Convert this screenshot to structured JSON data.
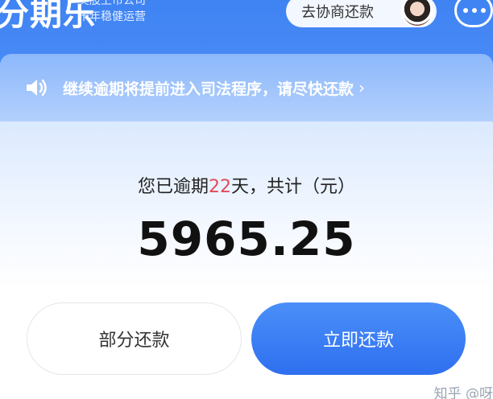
{
  "header": {
    "logo_text": "分期乐",
    "tagline_line1": "美股上市公司",
    "tagline_line2": "十年稳健运营",
    "negotiate_label": "去协商还款"
  },
  "notice": {
    "text": "继续逾期将提前进入司法程序，请尽快还款",
    "chevron": "›"
  },
  "summary": {
    "prefix": "您已逾期",
    "days": "22",
    "suffix": "天，共计（元）",
    "amount": "5965.25"
  },
  "actions": {
    "partial_label": "部分还款",
    "repay_label": "立即还款"
  },
  "watermark": "知乎 @呀",
  "colors": {
    "brand_blue": "#3f83f3",
    "overdue_red": "#e14b5a",
    "button_blue": "#2f6ff0"
  }
}
